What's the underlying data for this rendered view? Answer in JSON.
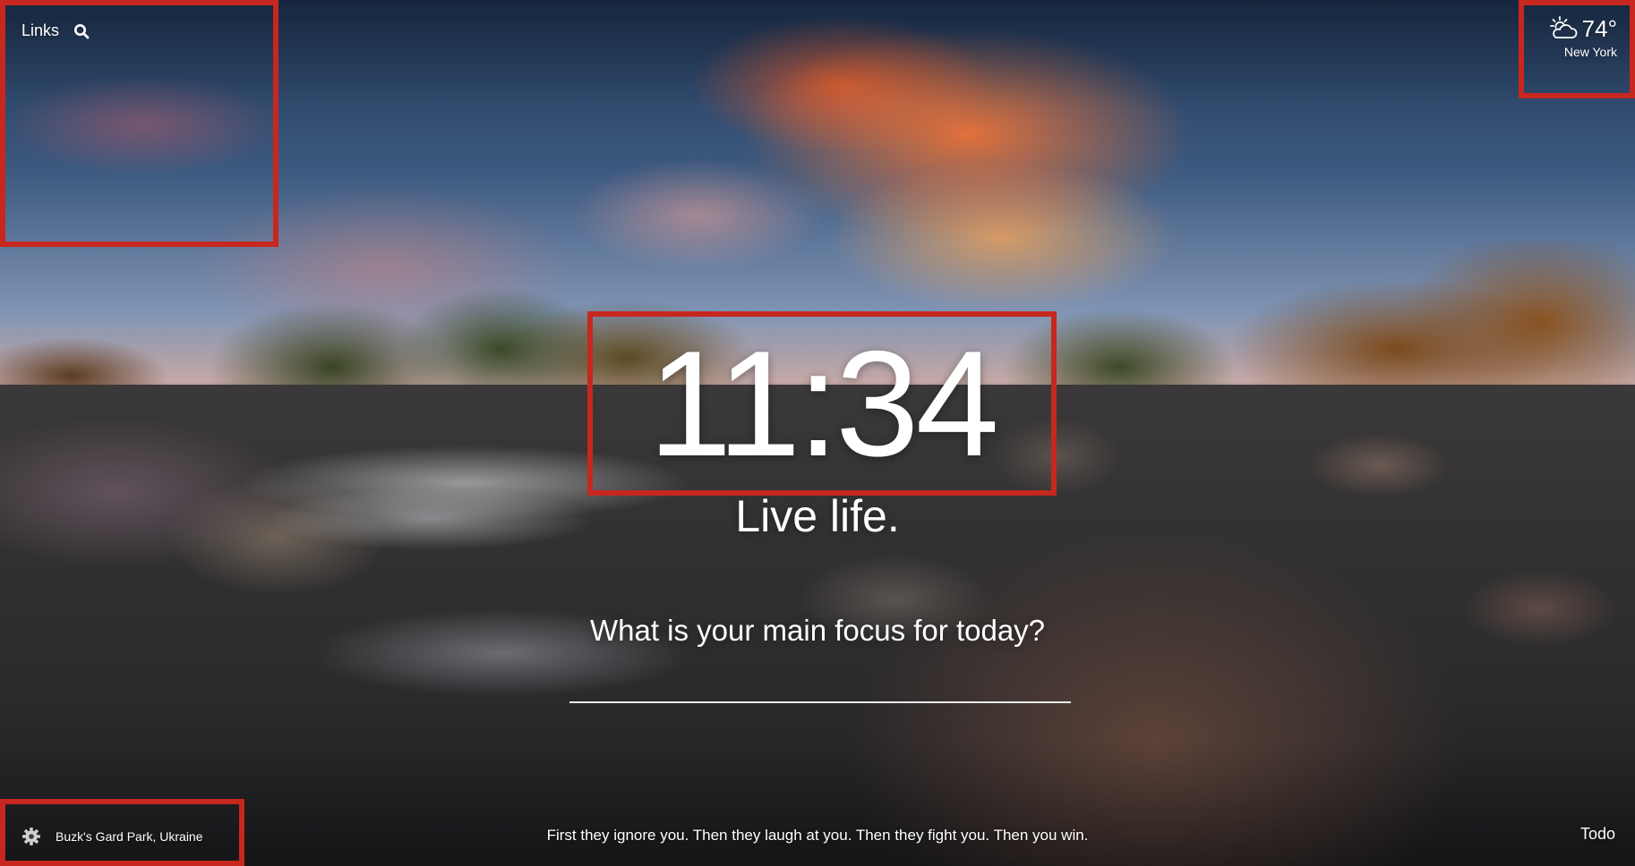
{
  "top_left": {
    "links_label": "Links",
    "search_icon": "search-icon"
  },
  "weather": {
    "icon": "partly-cloudy-icon",
    "temperature": "74°",
    "location": "New York"
  },
  "center": {
    "clock": "11:34",
    "greeting": "Live life.",
    "focus_question": "What is your main focus for today?",
    "focus_input_value": ""
  },
  "footer": {
    "settings_icon": "gear-icon",
    "photo_location": "Buzk's Gard Park, Ukraine",
    "quote": "First they ignore you. Then they laugh at you. Then they fight you. Then you win.",
    "todo_label": "Todo"
  },
  "colors": {
    "highlight_box": "#c6271f",
    "text": "#ffffff"
  }
}
